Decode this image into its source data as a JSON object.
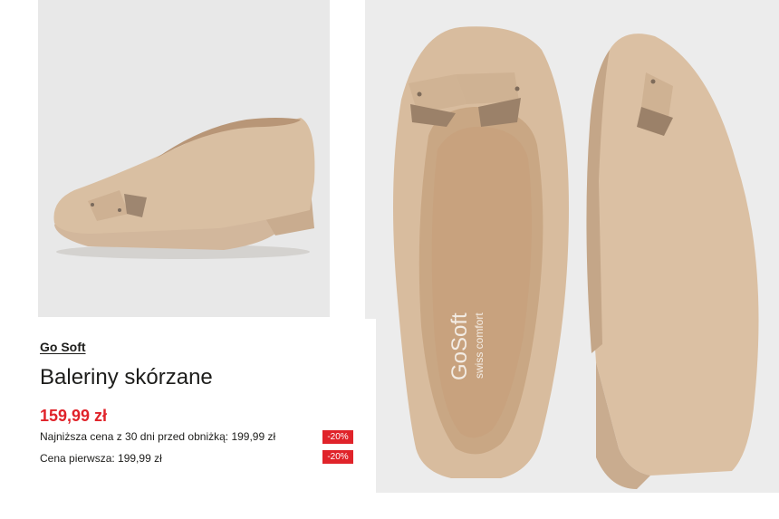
{
  "product": {
    "brand": "Go Soft",
    "name": "Baleriny skórzane",
    "price": "159,99 zł",
    "lowest_price_label": "Najniższa cena z 30 dni przed obniżką: 199,99 zł",
    "lowest_price_discount": "-20%",
    "first_price_label": "Cena pierwsza: 199,99 zł",
    "first_price_discount": "-20%"
  },
  "insole_logo": {
    "brand": "GoSoft",
    "tagline": "swiss comfort"
  },
  "colors": {
    "price_red": "#e0232a",
    "shoe_beige": "#c8a98a"
  }
}
